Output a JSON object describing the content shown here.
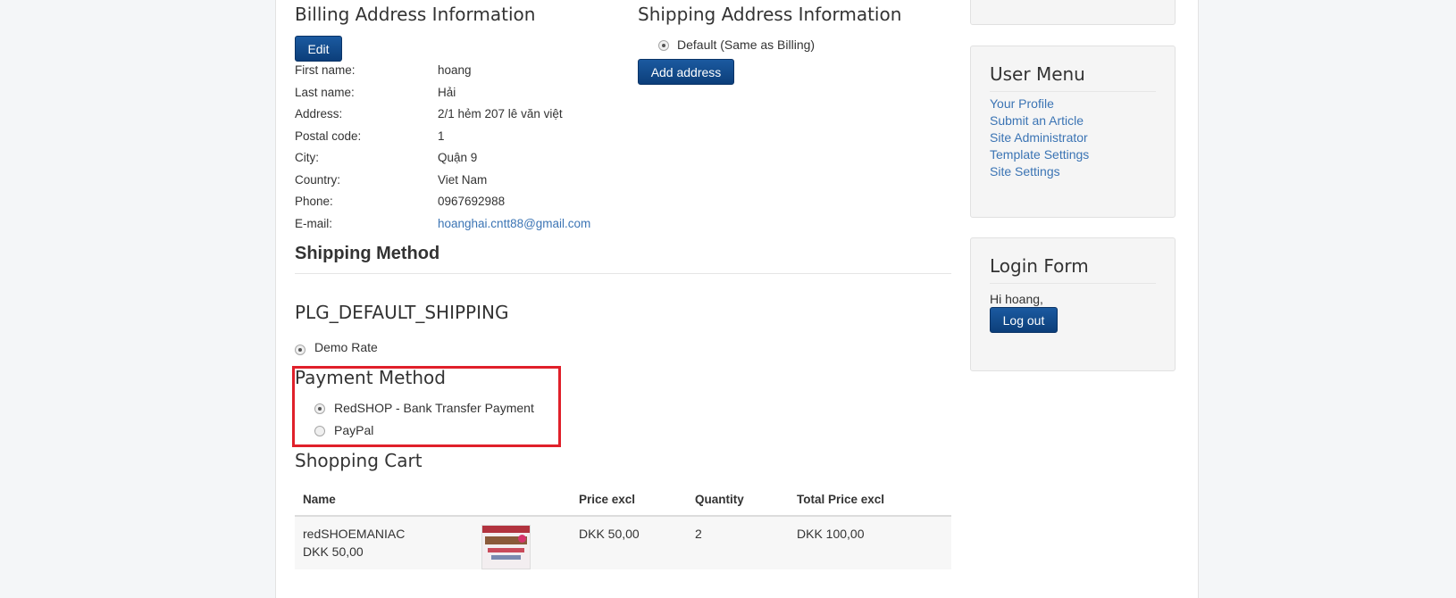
{
  "billing": {
    "title": "Billing Address Information",
    "edit_label": "Edit",
    "fields": [
      {
        "label": "First name:",
        "value": "hoang"
      },
      {
        "label": "Last name:",
        "value": "Hải"
      },
      {
        "label": "Address:",
        "value": "2/1 hẻm 207 lê văn việt"
      },
      {
        "label": "Postal code:",
        "value": "1"
      },
      {
        "label": "City:",
        "value": "Quận 9"
      },
      {
        "label": "Country:",
        "value": "Viet Nam"
      },
      {
        "label": "Phone:",
        "value": "0967692988"
      },
      {
        "label": "E-mail:",
        "value": "hoanghai.cntt88@gmail.com"
      }
    ]
  },
  "shipping_address": {
    "title": "Shipping Address Information",
    "default_option": "Default (Same as Billing)",
    "add_label": "Add address"
  },
  "shipping_method": {
    "title": "Shipping Method",
    "plugin_title": "PLG_DEFAULT_SHIPPING",
    "rate_option": "Demo Rate"
  },
  "payment_method": {
    "title": "Payment Method",
    "options": [
      "RedSHOP - Bank Transfer Payment",
      "PayPal"
    ],
    "selected": "RedSHOP - Bank Transfer Payment",
    "highlight_color": "#e0202a"
  },
  "cart": {
    "title": "Shopping Cart",
    "headers": [
      "Name",
      "Price excl",
      "Quantity",
      "Total Price excl"
    ],
    "rows": [
      {
        "name": "redSHOEMANIAC",
        "unit_price": "DKK 50,00",
        "price_excl": "DKK 50,00",
        "quantity": "2",
        "total": "DKK 100,00"
      }
    ]
  },
  "user_menu": {
    "title": "User Menu",
    "items": [
      "Your Profile",
      "Submit an Article",
      "Site Administrator",
      "Template Settings",
      "Site Settings"
    ]
  },
  "login_form": {
    "title": "Login Form",
    "greeting": "Hi hoang,",
    "logout_label": "Log out"
  },
  "colors": {
    "accent": "#0c3e7a",
    "link": "#3b74b4"
  }
}
